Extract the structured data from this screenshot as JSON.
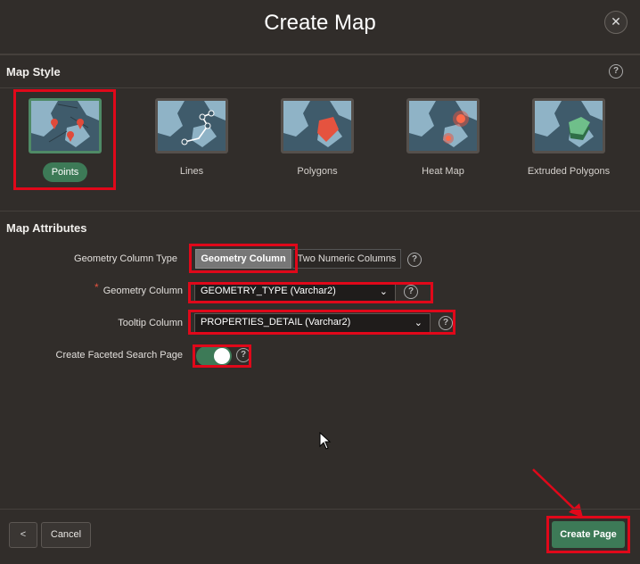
{
  "dialog": {
    "title": "Create Map",
    "close_icon": "close-icon"
  },
  "map_style": {
    "heading": "Map Style",
    "options": [
      {
        "label": "Points",
        "selected": true
      },
      {
        "label": "Lines",
        "selected": false
      },
      {
        "label": "Polygons",
        "selected": false
      },
      {
        "label": "Heat Map",
        "selected": false
      },
      {
        "label": "Extruded Polygons",
        "selected": false
      }
    ]
  },
  "map_attributes": {
    "heading": "Map Attributes",
    "geometry_column_type": {
      "label": "Geometry Column Type",
      "options": [
        "Geometry Column",
        "Two Numeric Columns"
      ],
      "selected": "Geometry Column"
    },
    "geometry_column": {
      "label": "Geometry Column",
      "required_marker": "*",
      "value": "GEOMETRY_TYPE (Varchar2)"
    },
    "tooltip_column": {
      "label": "Tooltip Column",
      "value": "PROPERTIES_DETAIL (Varchar2)"
    },
    "faceted_search": {
      "label": "Create Faceted Search Page",
      "enabled": true
    }
  },
  "footer": {
    "back_label": "<",
    "cancel_label": "Cancel",
    "create_label": "Create Page"
  },
  "colors": {
    "accent": "#3d7a57",
    "highlight": "#e0081a",
    "background": "#312d2a"
  },
  "help_glyph": "?"
}
